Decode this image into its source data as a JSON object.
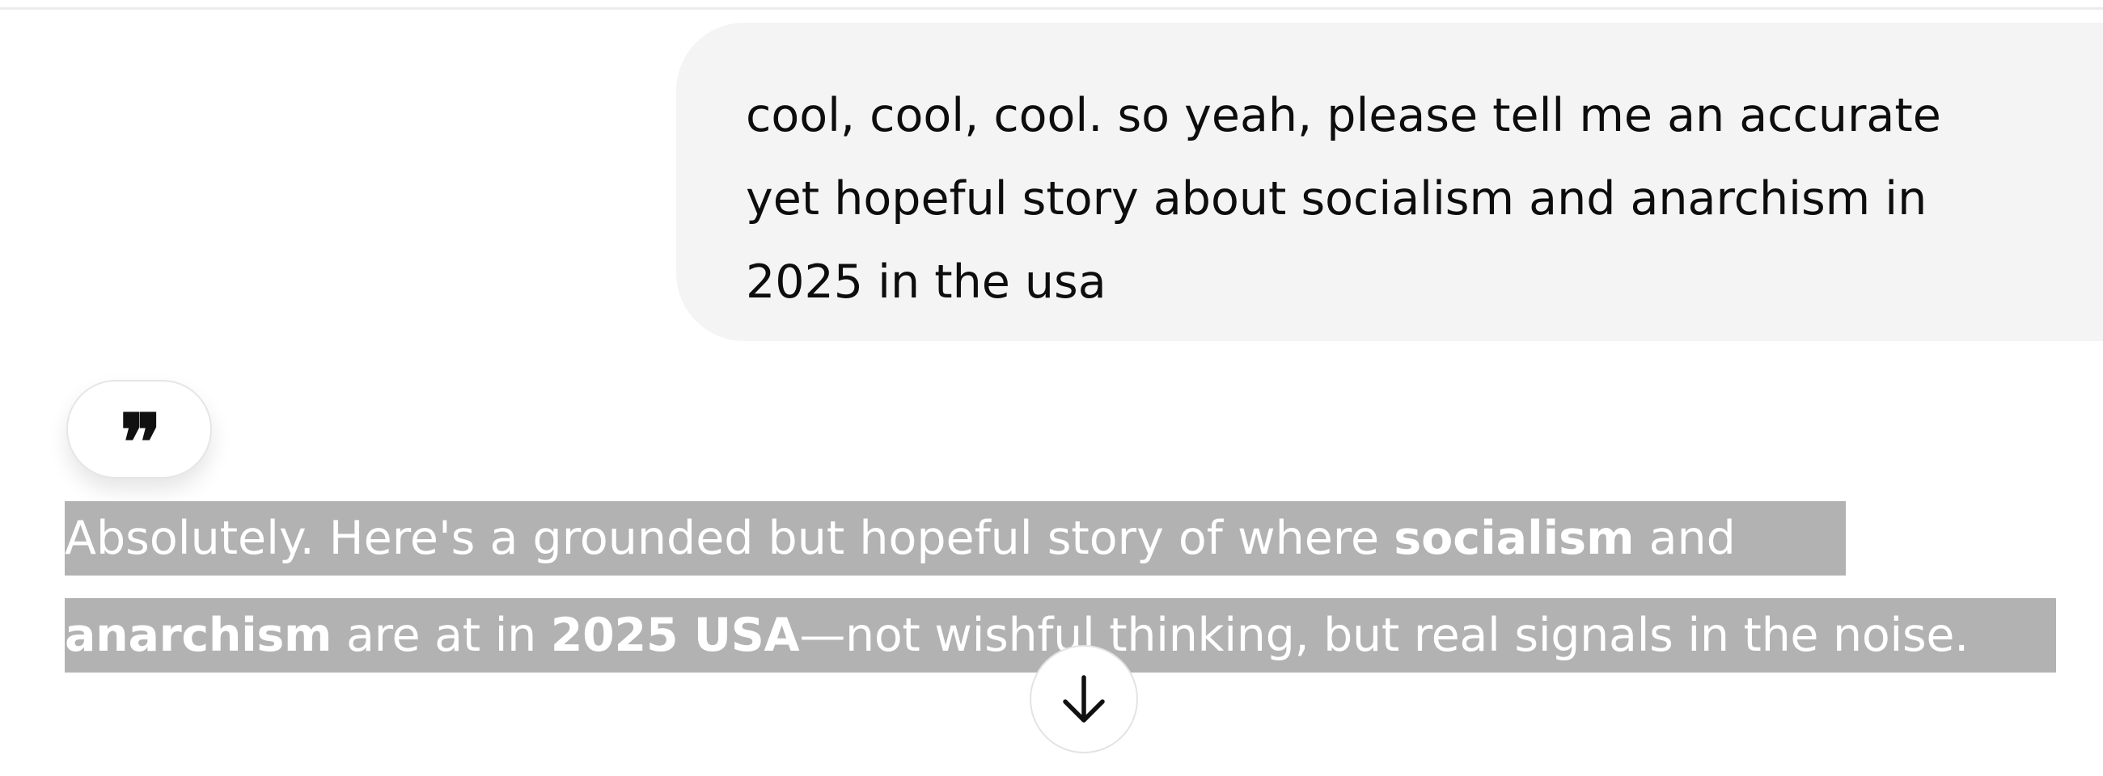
{
  "conversation": {
    "user_message": {
      "text": "cool, cool, cool. so yeah, please tell me an accurate yet hopeful story about socialism and anarchism in 2025 in the usa"
    },
    "quote_action": {
      "icon": "quote-icon",
      "glyph": "❞"
    },
    "assistant_message": {
      "line1": {
        "t1": "Absolutely. Here's a grounded but hopeful story of where ",
        "b1": "socialism",
        "t2": " and"
      },
      "line2": {
        "b1": "anarchism",
        "t1": " are at in ",
        "b2": "2025 USA",
        "t2": "—not wishful thinking, but real signals in the noise."
      }
    },
    "scroll_button": {
      "icon": "arrow-down-icon"
    }
  },
  "colors": {
    "user_bubble_bg": "#f4f4f4",
    "selection_highlight": "#b2b2b2",
    "text_dark": "#0d0d0d",
    "text_selected": "#ffffff"
  }
}
